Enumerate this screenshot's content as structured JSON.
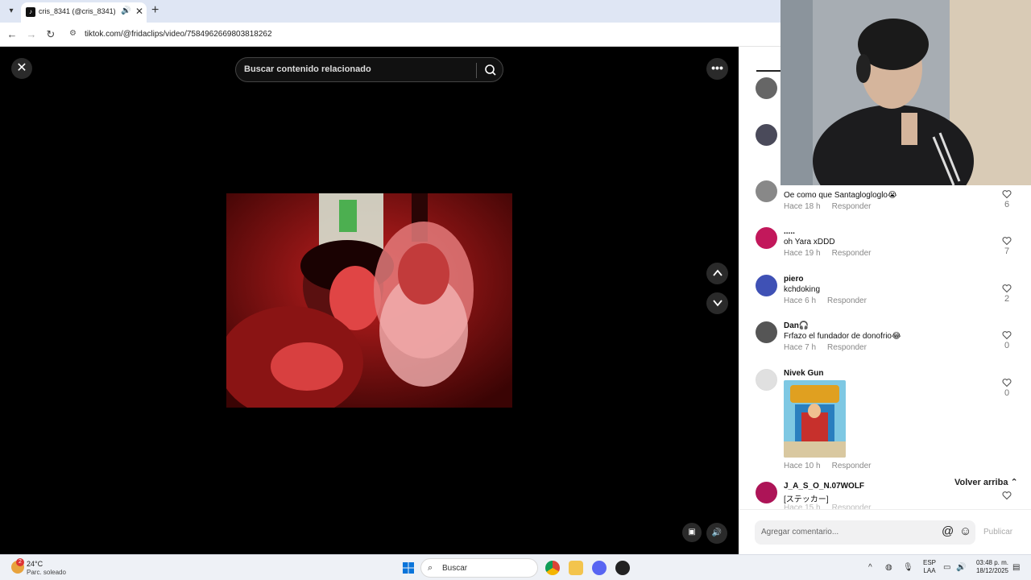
{
  "browser": {
    "tab_title": "cris_8341 (@cris_8341) | Tik",
    "url": "tiktok.com/@fridaclips/video/7584962669803818262",
    "tab_new": "+",
    "tab_close": "✕",
    "tab_audio": "🔊",
    "nav_back": "←",
    "nav_forward": "→",
    "nav_reload": "↻"
  },
  "video": {
    "search_placeholder": "Buscar contenido relacionado",
    "close_icon": "✕",
    "more_icon": "•••"
  },
  "comments": {
    "items": [
      {
        "user": "Oe como que Santagloglogl",
        "text": "Oe como que Santaglogloglo😭",
        "time": "Hace 18 h",
        "reply": "Responder",
        "likes": "6"
      },
      {
        "user": ".....",
        "text": "oh Yara xDDD",
        "time": "Hace 19 h",
        "reply": "Responder",
        "likes": "7"
      },
      {
        "user": "piero",
        "text": "kchdoking",
        "time": "Hace 6 h",
        "reply": "Responder",
        "likes": "2"
      },
      {
        "user": "Dan🎧",
        "text": "Frfazo el fundador de donofrio😂",
        "time": "Hace 7 h",
        "reply": "Responder",
        "likes": "0"
      },
      {
        "user": "Nivek Gun",
        "text": "",
        "time": "Hace 10 h",
        "reply": "Responder",
        "likes": "0"
      },
      {
        "user": "J_A_S_O_N.07WOLF",
        "text": "[ステッカー]",
        "time": "Hace 15 h",
        "reply": "Responder",
        "likes": ""
      }
    ],
    "back_to_top": "Volver arriba",
    "input_placeholder": "Agregar comentario...",
    "publish": "Publicar",
    "at_icon": "@",
    "emoji_icon": "☺"
  },
  "taskbar": {
    "temp": "24°C",
    "condition": "Parc. soleado",
    "weather_badge": "2",
    "search_label": "Buscar",
    "lang_1": "ESP",
    "lang_2": "LAA",
    "time": "03:48 p. m.",
    "date": "18/12/2025"
  },
  "colors": {
    "accent_red": "#fe2c55",
    "video_tint": "#b01818"
  }
}
